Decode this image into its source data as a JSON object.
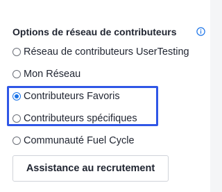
{
  "section": {
    "title": "Options de réseau de contributeurs",
    "info_icon": "info-circle-icon"
  },
  "options": [
    {
      "label": "Réseau de contributeurs UserTesting",
      "checked": false
    },
    {
      "label": "Mon Réseau",
      "checked": false
    },
    {
      "label": "Contributeurs Favoris",
      "checked": true
    },
    {
      "label": "Contributeurs spécifiques",
      "checked": false
    },
    {
      "label": "Communauté Fuel Cycle",
      "checked": false
    }
  ],
  "button": {
    "label": "Assistance au recrutement"
  },
  "colors": {
    "accent": "#1a73e8",
    "highlight": "#2f56e6"
  }
}
